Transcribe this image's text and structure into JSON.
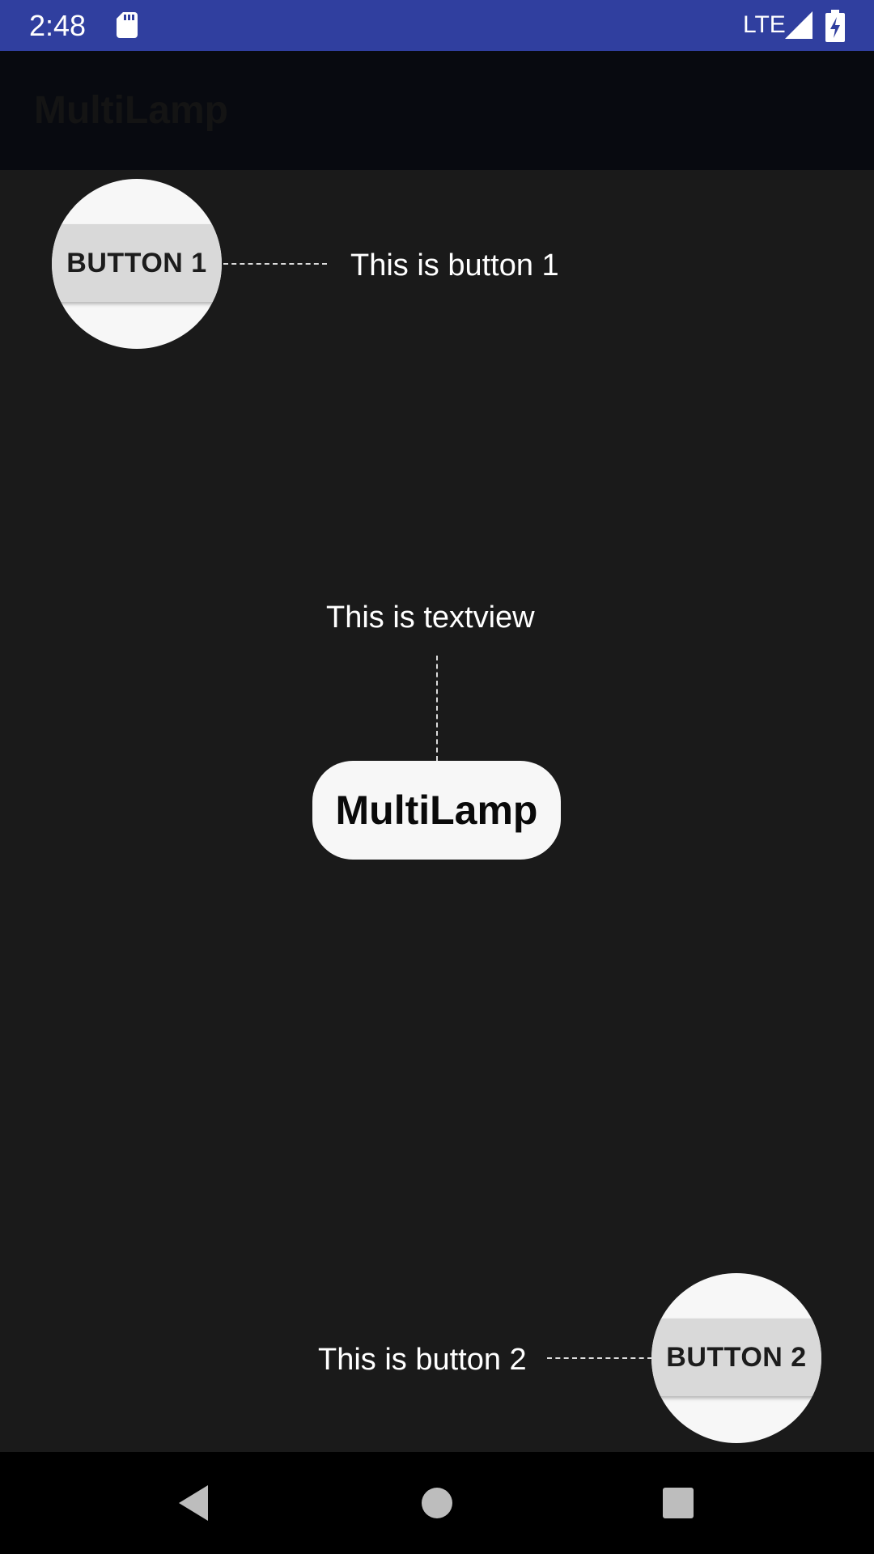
{
  "status_bar": {
    "time": "2:48",
    "network": "LTE",
    "background_color": "#303f9f",
    "icons": [
      "sd-card-icon",
      "signal-icon",
      "battery-charging-icon"
    ]
  },
  "app_bar": {
    "title": "MultiLamp",
    "background_color": "#080a10"
  },
  "overlay": {
    "button1": {
      "label": "BUTTON 1",
      "hint": "This is button 1"
    },
    "textview": {
      "label": "MultiLamp",
      "hint": "This is textview"
    },
    "button2": {
      "label": "BUTTON 2",
      "hint": "This is button 2"
    },
    "spotlight_color": "#f7f7f7",
    "dim_color": "#1a1a1a"
  },
  "nav_bar": {
    "icons": [
      "back-icon",
      "home-icon",
      "recents-icon"
    ]
  }
}
